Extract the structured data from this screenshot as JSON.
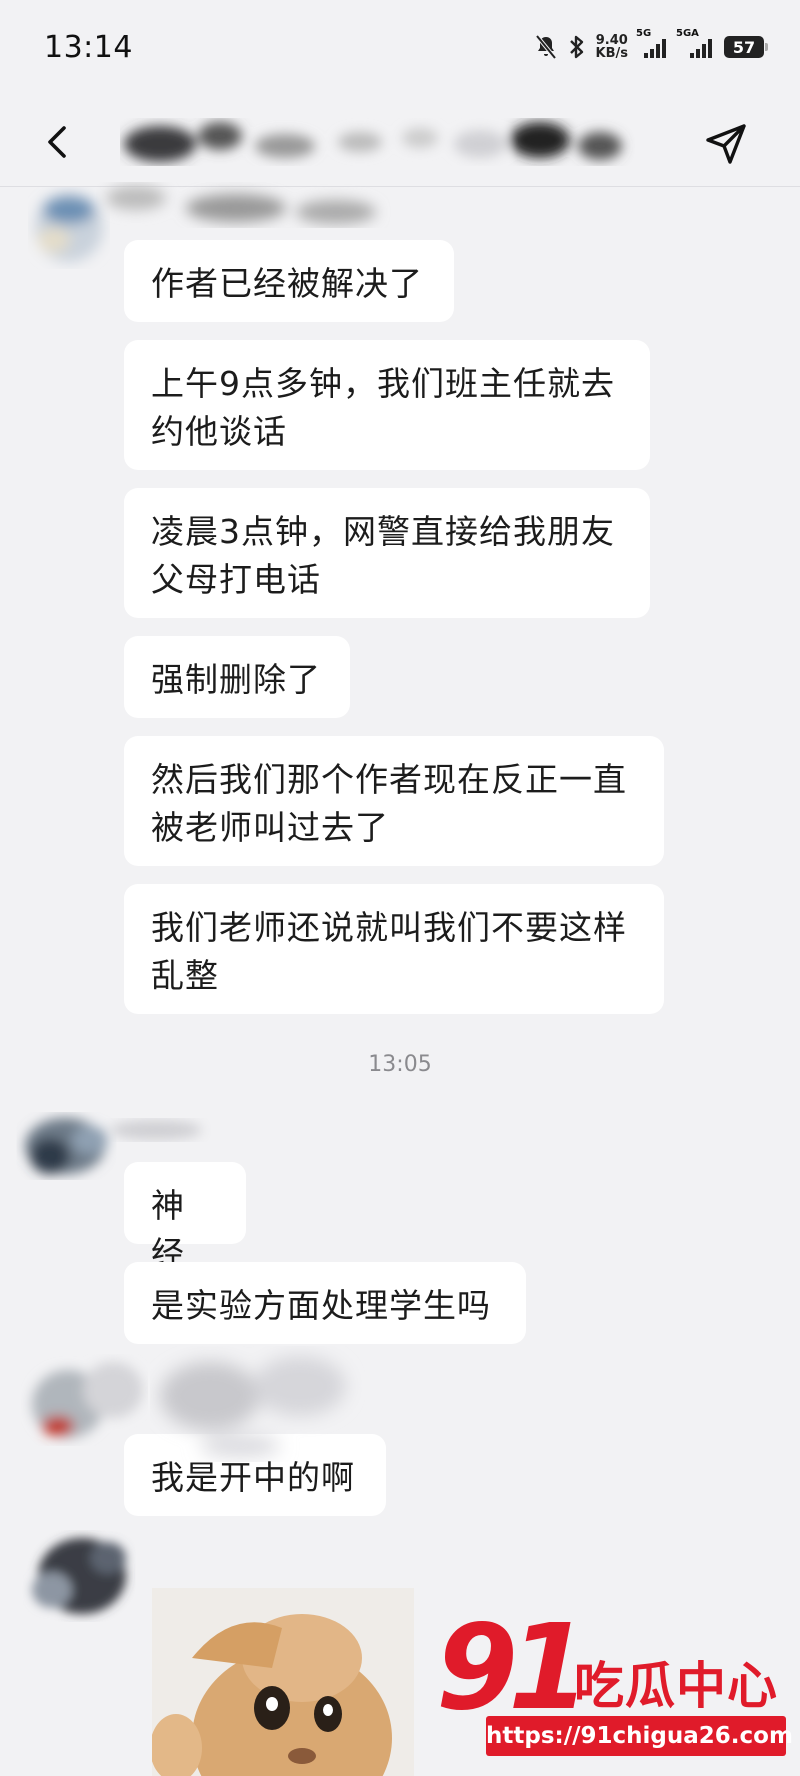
{
  "status_bar": {
    "time": "13:14",
    "net_speed_value": "9.40",
    "net_speed_unit": "KB/s",
    "sim1_label": "5G",
    "sim2_label": "5GA",
    "battery": "57"
  },
  "header": {
    "back_icon": "chevron-left-icon",
    "action_icon": "send-icon"
  },
  "messages_block1": [
    "作者已经被解决了",
    "上午9点多钟，我们班主任就去约他谈话",
    "凌晨3点钟，网警直接给我朋友父母打电话",
    "强制删除了",
    "然后我们那个作者现在反正一直被老师叫过去了",
    "我们老师还说就叫我们不要这样乱整"
  ],
  "timestamp": "13:05",
  "messages_block2": [
    "神经",
    "是实验方面处理学生吗"
  ],
  "messages_block3": [
    "我是开中的啊"
  ],
  "watermark": {
    "number": "91",
    "brand": "吃瓜中心",
    "url": "https://91chigua26.com"
  },
  "colors": {
    "background": "#f2f2f4",
    "bubble": "#ffffff",
    "watermark_red": "#e01b2a"
  }
}
